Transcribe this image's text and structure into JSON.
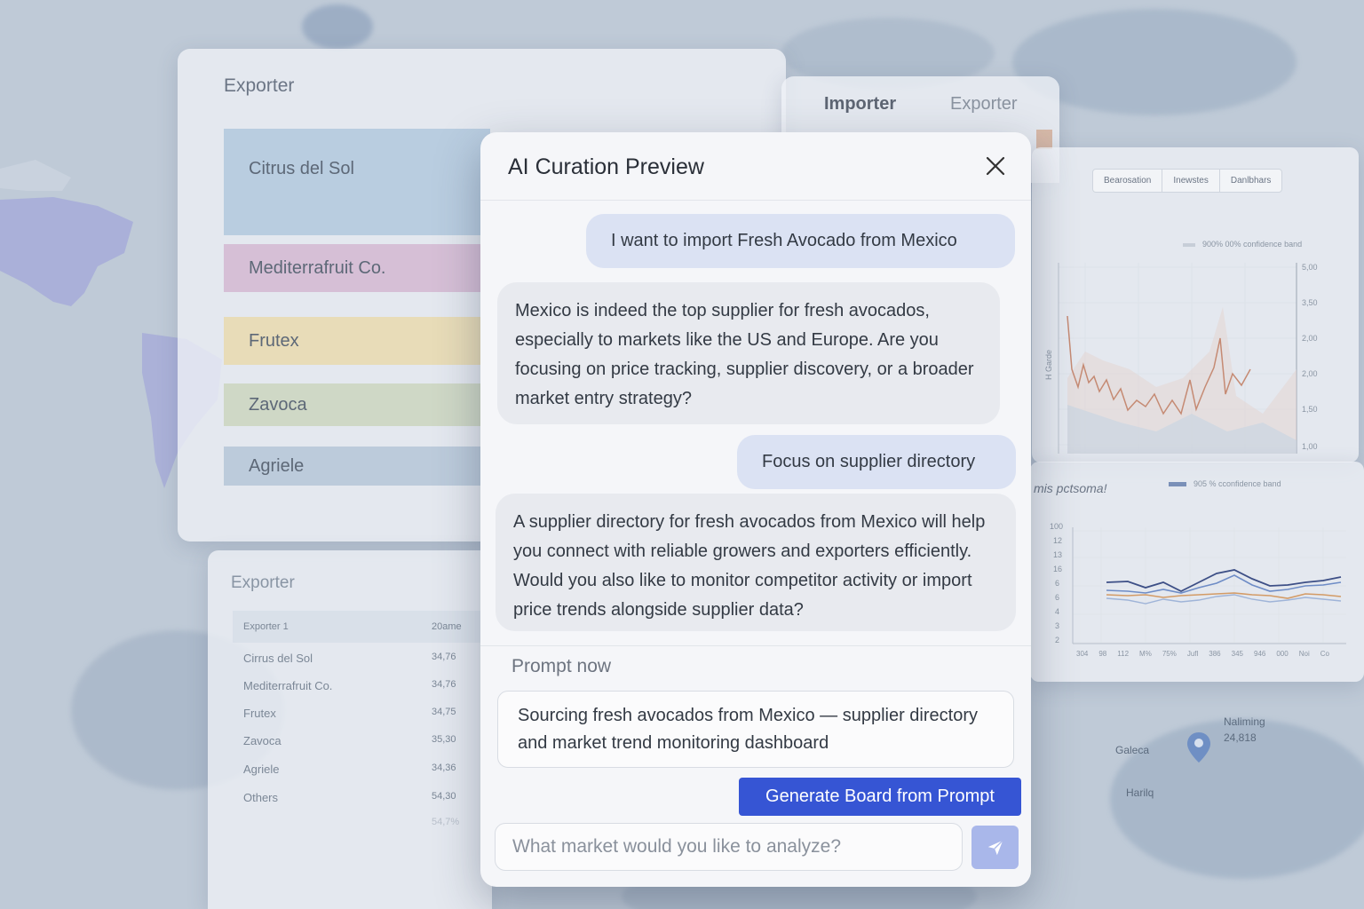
{
  "sankey_panel": {
    "title": "Exporter",
    "items": [
      {
        "label": "Citrus del Sol",
        "color": "#b9cde0"
      },
      {
        "label": "Mediterrafruit Co.",
        "color": "#d6bfd6"
      },
      {
        "label": "Frutex",
        "color": "#e8dcb8"
      },
      {
        "label": "Zavoca",
        "color": "#cfd8c6"
      },
      {
        "label": "Agriele",
        "color": "#bccbdb"
      }
    ]
  },
  "tab_panel": {
    "tabs": [
      {
        "label": "Importer"
      },
      {
        "label": "Exporter"
      }
    ]
  },
  "chart_top": {
    "segments": [
      "Bearosation",
      "Inewstes",
      "Danlbhars"
    ],
    "legend": "900%  00% confidence band",
    "y_ticks": [
      "5,00",
      "3,50",
      "2,00",
      "2,00",
      "1,50",
      "1,00"
    ],
    "y_axis_label": "H Garde"
  },
  "chart_bottom": {
    "title": "mis pctsoma!",
    "legend": "905 % cconfidence band",
    "y_ticks": [
      "100",
      "12",
      "13",
      "16",
      "6",
      "6",
      "4",
      "3",
      "2"
    ],
    "x_ticks": [
      "304",
      "98",
      "112",
      "M%",
      "75%",
      "Jufl",
      "386",
      "345",
      "946",
      "000",
      "Noi",
      "Co"
    ]
  },
  "table_panel": {
    "title": "Exporter",
    "headers": [
      "Exporter 1",
      "20ame"
    ],
    "rows": [
      {
        "name": "Cirrus del Sol",
        "value": "34,76"
      },
      {
        "name": "Mediterrafruit Co.",
        "value": "34,76"
      },
      {
        "name": "Frutex",
        "value": "34,75"
      },
      {
        "name": "Zavoca",
        "value": "35,30"
      },
      {
        "name": "Agriele",
        "value": "34,36"
      },
      {
        "name": "Others",
        "value": "54,30"
      }
    ],
    "extra_value": "54,7%"
  },
  "map": {
    "labels": [
      "Naliming",
      "24,818",
      "Galeca",
      "Harilq"
    ]
  },
  "modal": {
    "title": "AI Curation Preview",
    "messages": [
      {
        "role": "user",
        "text": "I want to import Fresh Avocado from Mexico"
      },
      {
        "role": "ai",
        "text": "Mexico is indeed the top supplier for fresh avocados, especially to markets like the US and Europe. Are you focusing on price tracking, supplier discovery, or a broader market entry strategy?"
      },
      {
        "role": "user",
        "text": "Focus on supplier directory"
      },
      {
        "role": "ai",
        "text": "A supplier directory for fresh avocados from Mexico will help you connect with reliable growers and exporters efficiently. Would you also like to monitor competitor activity or import price trends alongside supplier data?"
      }
    ],
    "prompt_label": "Prompt now",
    "prompt_text": "Sourcing fresh avocados from Mexico — supplier directory and market trend monitoring dashboard",
    "generate_label": "Generate Board from Prompt",
    "input_placeholder": "What market would you like to analyze?",
    "accent_color": "#3655d4"
  }
}
